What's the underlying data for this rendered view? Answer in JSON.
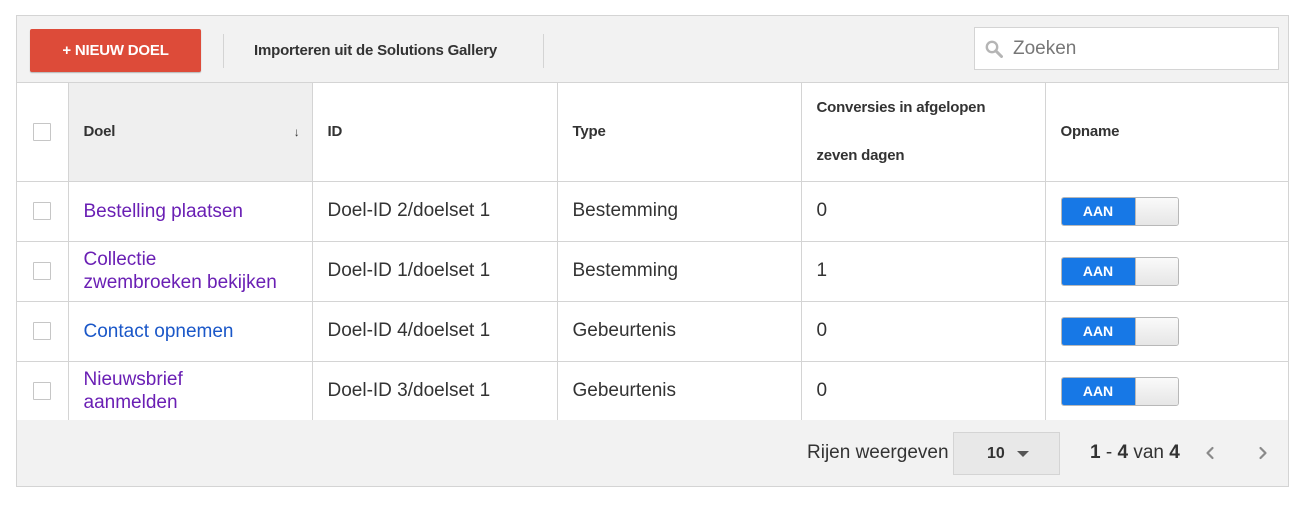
{
  "toolbar": {
    "new_goal_label": "+ NIEUW DOEL",
    "import_label": "Importeren uit de Solutions Gallery",
    "search_placeholder": "Zoeken"
  },
  "table": {
    "columns": [
      {
        "label": "Doel",
        "sorted": true
      },
      {
        "label": "ID"
      },
      {
        "label": "Type"
      },
      {
        "label_line1": "Conversies in afgelopen",
        "label_line2": "zeven dagen"
      },
      {
        "label": "Opname"
      }
    ],
    "sort_indicator": "↓",
    "rows": [
      {
        "name": "Bestelling plaatsen",
        "id": "Doel-ID 2/doelset 1",
        "type": "Bestemming",
        "conversions": "0",
        "recording": "AAN"
      },
      {
        "name_line1": "Collectie",
        "name_line2": "zwembroeken bekijken",
        "id": "Doel-ID 1/doelset 1",
        "type": "Bestemming",
        "conversions": "1",
        "recording": "AAN"
      },
      {
        "name": "Contact opnemen",
        "id": "Doel-ID 4/doelset 1",
        "type": "Gebeurtenis",
        "conversions": "0",
        "recording": "AAN"
      },
      {
        "name_line1": "Nieuwsbrief",
        "name_line2": "aanmelden",
        "id": "Doel-ID 3/doelset 1",
        "type": "Gebeurtenis",
        "conversions": "0",
        "recording": "AAN"
      }
    ]
  },
  "footer": {
    "rows_label": "Rijen weergeven",
    "rows_value": "10",
    "range_start": "1",
    "range_sep": " - ",
    "range_end": "4",
    "range_of": " van ",
    "range_total": "4"
  },
  "colors": {
    "new_button": "#dd4b39",
    "toggle_on": "#1778e6",
    "link_visited": "#6a1fb4",
    "link": "#1a57c8"
  },
  "icons": {
    "search": "search-icon",
    "prev": "chevron-left-icon",
    "next": "chevron-right-icon",
    "sort": "sort-arrow-icon",
    "dropdown": "caret-down-icon"
  }
}
